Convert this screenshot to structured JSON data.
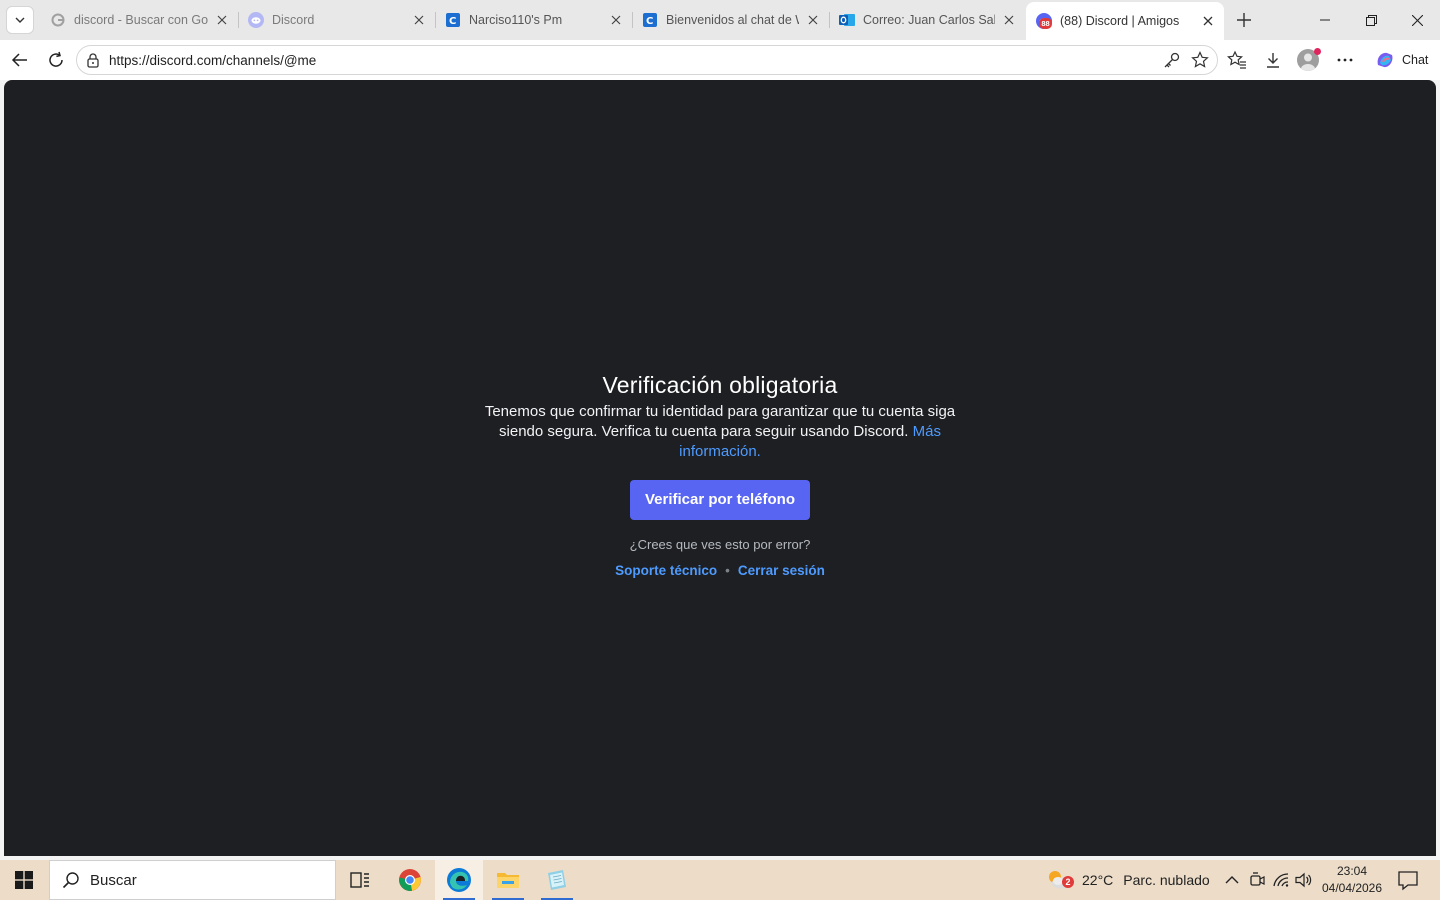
{
  "browser": {
    "tabs": [
      {
        "title": "discord - Buscar con Google",
        "favicon": "google-g-icon"
      },
      {
        "title": "Discord",
        "favicon": "discord-icon"
      },
      {
        "title": "Narciso110's Pm",
        "favicon": "chat-site-icon"
      },
      {
        "title": "Bienvenidos al chat de Web",
        "favicon": "chat-site-icon"
      },
      {
        "title": "Correo: Juan Carlos Salazar",
        "favicon": "outlook-icon"
      },
      {
        "title": "(88) Discord | Amigos",
        "favicon": "discord-notification-icon",
        "badge": "88"
      }
    ],
    "url": "https://discord.com/channels/@me",
    "chat_label": "Chat"
  },
  "page": {
    "title": "Verificación obligatoria",
    "description": "Tenemos que confirmar tu identidad para garantizar que tu cuenta siga siendo segura. Verifica tu cuenta para seguir usando Discord.",
    "more_info_link": "Más información.",
    "verify_button": "Verificar por teléfono",
    "error_question": "¿Crees que ves esto por error?",
    "support_link": "Soporte técnico",
    "separator": "•",
    "logout_link": "Cerrar sesión"
  },
  "taskbar": {
    "search_placeholder": "Buscar",
    "weather_badge": "2",
    "weather_temp": "22°C",
    "weather_condition": "Parc. nublado",
    "time": "23:04",
    "date": "04/04/2026"
  },
  "colors": {
    "discord_bg": "#1e1f22",
    "blurple": "#5865f2",
    "link": "#4e9bff",
    "taskbar": "#ecdcc8"
  }
}
